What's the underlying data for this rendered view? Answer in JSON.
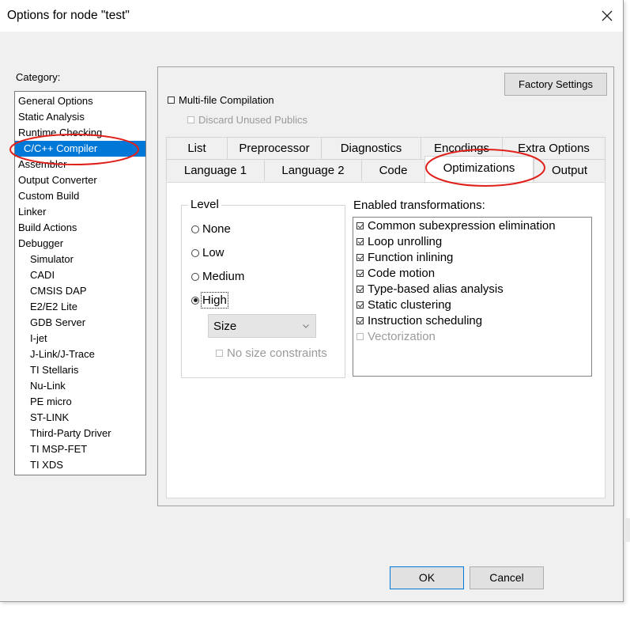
{
  "window": {
    "title": "Options for node \"test\"",
    "close_icon": "close-icon"
  },
  "category": {
    "label": "Category:",
    "items": [
      {
        "label": "General Options",
        "level": 0
      },
      {
        "label": "Static Analysis",
        "level": 0
      },
      {
        "label": "Runtime Checking",
        "level": 0
      },
      {
        "label": "C/C++ Compiler",
        "level": 0,
        "selected": true
      },
      {
        "label": "Assembler",
        "level": 0
      },
      {
        "label": "Output Converter",
        "level": 0
      },
      {
        "label": "Custom Build",
        "level": 0
      },
      {
        "label": "Linker",
        "level": 0
      },
      {
        "label": "Build Actions",
        "level": 0
      },
      {
        "label": "Debugger",
        "level": 0
      },
      {
        "label": "Simulator",
        "level": 1
      },
      {
        "label": "CADI",
        "level": 1
      },
      {
        "label": "CMSIS DAP",
        "level": 1
      },
      {
        "label": "E2/E2 Lite",
        "level": 1
      },
      {
        "label": "GDB Server",
        "level": 1
      },
      {
        "label": "I-jet",
        "level": 1
      },
      {
        "label": "J-Link/J-Trace",
        "level": 1
      },
      {
        "label": "TI Stellaris",
        "level": 1
      },
      {
        "label": "Nu-Link",
        "level": 1
      },
      {
        "label": "PE micro",
        "level": 1
      },
      {
        "label": "ST-LINK",
        "level": 1
      },
      {
        "label": "Third-Party Driver",
        "level": 1
      },
      {
        "label": "TI MSP-FET",
        "level": 1
      },
      {
        "label": "TI XDS",
        "level": 1
      }
    ]
  },
  "factory_settings_label": "Factory Settings",
  "multifile": {
    "label": "Multi-file Compilation",
    "checked": false
  },
  "discard": {
    "label": "Discard Unused Publics",
    "checked": false,
    "disabled": true
  },
  "tabs": {
    "row1": [
      "List",
      "Preprocessor",
      "Diagnostics",
      "Encodings",
      "Extra Options"
    ],
    "row2": [
      "Language 1",
      "Language 2",
      "Code",
      "Optimizations",
      "Output"
    ],
    "active": "Optimizations"
  },
  "level": {
    "legend": "Level",
    "options": [
      "None",
      "Low",
      "Medium",
      "High"
    ],
    "selected": "High",
    "goal_select": "Size",
    "no_size_constraints": "No size constraints"
  },
  "transformations": {
    "label": "Enabled transformations:",
    "items": [
      {
        "label": "Common subexpression elimination",
        "checked": true
      },
      {
        "label": "Loop unrolling",
        "checked": true
      },
      {
        "label": "Function inlining",
        "checked": true
      },
      {
        "label": "Code motion",
        "checked": true
      },
      {
        "label": "Type-based alias analysis",
        "checked": true
      },
      {
        "label": "Static clustering",
        "checked": true
      },
      {
        "label": "Instruction scheduling",
        "checked": true
      },
      {
        "label": "Vectorization",
        "checked": false,
        "disabled": true
      }
    ]
  },
  "buttons": {
    "ok": "OK",
    "cancel": "Cancel"
  },
  "colors": {
    "selection": "#0078d7",
    "annotation": "#e0201b"
  }
}
